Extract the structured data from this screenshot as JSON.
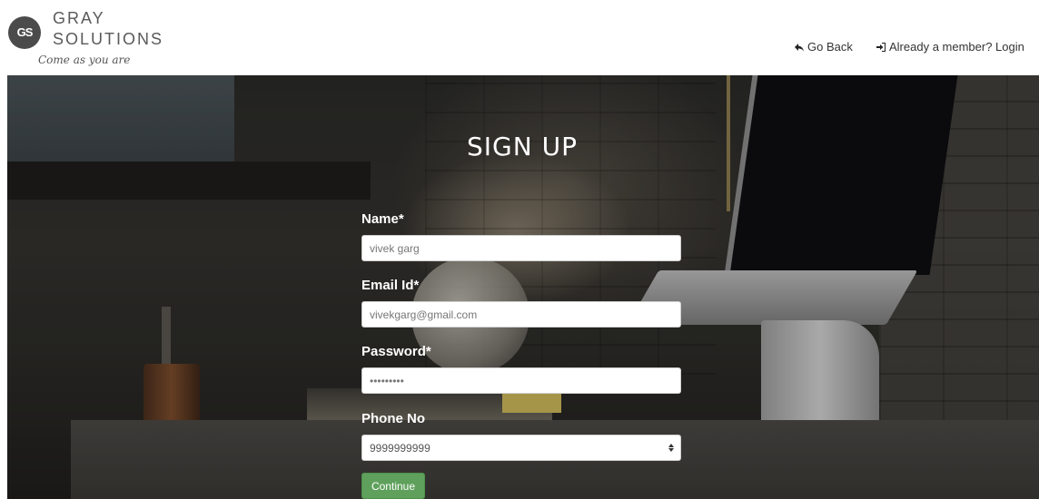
{
  "brand": {
    "mark": "GS",
    "line1": "GRAY",
    "line2": "SOLUTIONS",
    "tagline": "Come as you are"
  },
  "nav": {
    "back_label": "Go Back",
    "back_icon": "reply-arrow-icon",
    "login_label": "Already a member? Login",
    "login_icon": "sign-in-icon"
  },
  "form": {
    "title": "SIGN UP",
    "name_label": "Name*",
    "name_value": "vivek garg",
    "email_label": "Email Id*",
    "email_value": "vivekgarg@gmail.com",
    "password_label": "Password*",
    "password_value": "•••••••••",
    "phone_label": "Phone No",
    "phone_value": "9999999999",
    "continue_label": "Continue"
  },
  "colors": {
    "continue_button": "#5fa15c",
    "header_bg": "#ffffff",
    "text_on_hero": "#ffffff"
  }
}
